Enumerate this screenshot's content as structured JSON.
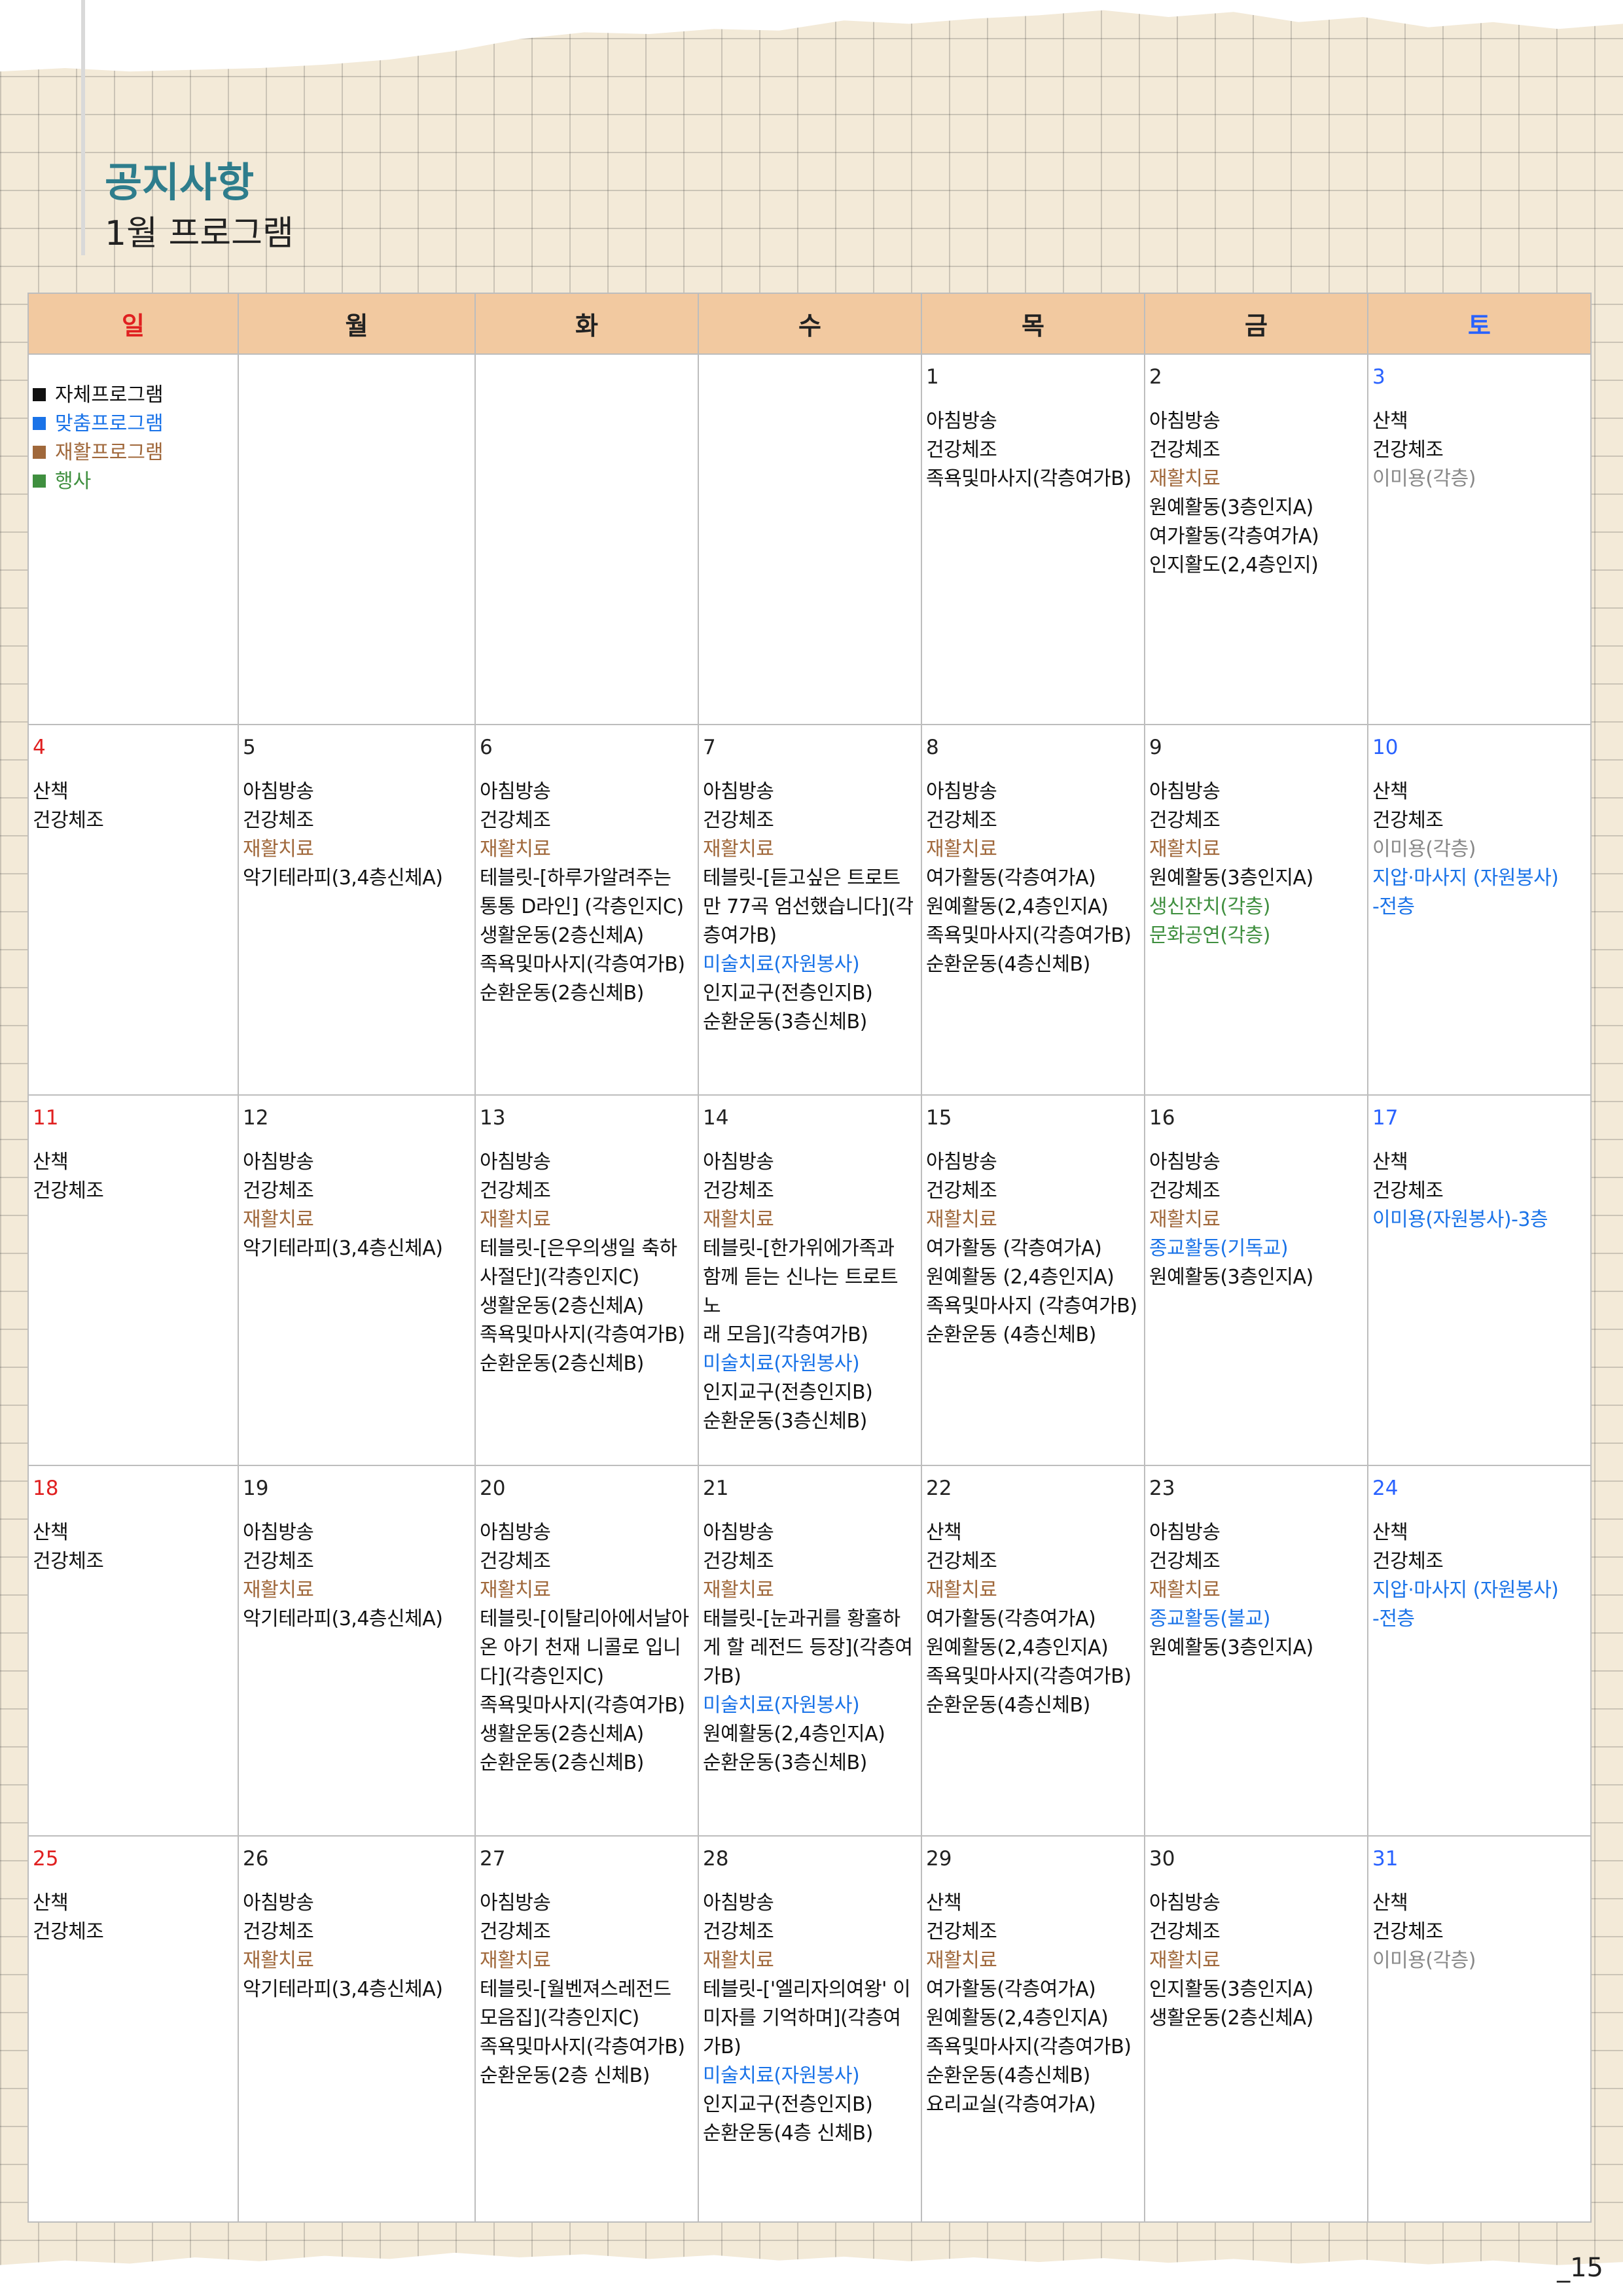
{
  "header": {
    "notice_title": "공지사항",
    "program_title": "1월 프로그램"
  },
  "page_number": "_15",
  "colors": {
    "self": "#000000",
    "custom": "#1a73e8",
    "rehab": "#a0683b",
    "event": "#3f8f3f",
    "sunday": "#e02020",
    "saturday": "#2962ff"
  },
  "weekdays": [
    "일",
    "월",
    "화",
    "수",
    "목",
    "금",
    "토"
  ],
  "legend": [
    {
      "label": "자체프로그램",
      "color": "#111111"
    },
    {
      "label": "맞춤프로그램",
      "color": "#1a73e8"
    },
    {
      "label": "재활프로그램",
      "color": "#a0683b"
    },
    {
      "label": "행사",
      "color": "#3f8f3f"
    }
  ],
  "weeks": [
    [
      null,
      null,
      null,
      null,
      {
        "day": "1",
        "items": [
          [
            "아침방송",
            ""
          ],
          [
            "건강체조",
            ""
          ],
          [
            "족욕및마사지(각층여가B)",
            ""
          ]
        ]
      },
      {
        "day": "2",
        "items": [
          [
            "아침방송",
            ""
          ],
          [
            "건강체조",
            ""
          ],
          [
            "재활치료",
            "rehab"
          ],
          [
            "원예활동(3층인지A)",
            ""
          ],
          [
            "여가활동(각층여가A)",
            ""
          ],
          [
            "인지활도(2,4층인지)",
            ""
          ]
        ]
      },
      {
        "day": "3",
        "items": [
          [
            "산책",
            ""
          ],
          [
            "건강체조",
            ""
          ],
          [
            "이미용(각층)",
            "grey"
          ]
        ]
      }
    ],
    [
      {
        "day": "4",
        "items": [
          [
            "산책",
            ""
          ],
          [
            "건강체조",
            ""
          ]
        ]
      },
      {
        "day": "5",
        "items": [
          [
            "아침방송",
            ""
          ],
          [
            "건강체조",
            ""
          ],
          [
            "재활치료",
            "rehab"
          ],
          [
            "악기테라피(3,4층신체A)",
            ""
          ]
        ]
      },
      {
        "day": "6",
        "items": [
          [
            "아침방송",
            ""
          ],
          [
            "건강체조",
            ""
          ],
          [
            "재활치료",
            "rehab"
          ],
          [
            "테블릿-[하루가알려주는",
            ""
          ],
          [
            "통통 D라인] (각층인지C)",
            ""
          ],
          [
            "생활운동(2층신체A)",
            ""
          ],
          [
            "족욕및마사지(각층여가B)",
            ""
          ],
          [
            "순환운동(2층신체B)",
            ""
          ]
        ]
      },
      {
        "day": "7",
        "items": [
          [
            "아침방송",
            ""
          ],
          [
            "건강체조",
            ""
          ],
          [
            "재활치료",
            "rehab"
          ],
          [
            "테블릿-[듣고싶은 트로트",
            ""
          ],
          [
            "만 77곡 엄선했습니다](각",
            ""
          ],
          [
            "층여가B)",
            ""
          ],
          [
            "미술치료(자원봉사)",
            "custom"
          ],
          [
            "인지교구(전층인지B)",
            ""
          ],
          [
            "순환운동(3층신체B)",
            ""
          ]
        ]
      },
      {
        "day": "8",
        "items": [
          [
            "아침방송",
            ""
          ],
          [
            "건강체조",
            ""
          ],
          [
            "재활치료",
            "rehab"
          ],
          [
            "여가활동(각층여가A)",
            ""
          ],
          [
            "원예활동(2,4층인지A)",
            ""
          ],
          [
            "족욕및마사지(각층여가B)",
            ""
          ],
          [
            "순환운동(4층신체B)",
            ""
          ]
        ]
      },
      {
        "day": "9",
        "items": [
          [
            "아침방송",
            ""
          ],
          [
            "건강체조",
            ""
          ],
          [
            "재활치료",
            "rehab"
          ],
          [
            "원예활동(3층인지A)",
            ""
          ],
          [
            "생신잔치(각층)",
            "event"
          ],
          [
            "문화공연(각층)",
            "event"
          ]
        ]
      },
      {
        "day": "10",
        "items": [
          [
            "산책",
            ""
          ],
          [
            "건강체조",
            ""
          ],
          [
            "이미용(각층)",
            "grey"
          ],
          [
            "지압·마사지 (자원봉사)",
            "custom"
          ],
          [
            "-전층",
            "custom"
          ]
        ]
      }
    ],
    [
      {
        "day": "11",
        "items": [
          [
            "산책",
            ""
          ],
          [
            "건강체조",
            ""
          ]
        ]
      },
      {
        "day": "12",
        "items": [
          [
            "아침방송",
            ""
          ],
          [
            "건강체조",
            ""
          ],
          [
            "재활치료",
            "rehab"
          ],
          [
            "악기테라피(3,4층신체A)",
            ""
          ]
        ]
      },
      {
        "day": "13",
        "items": [
          [
            "아침방송",
            ""
          ],
          [
            "건강체조",
            ""
          ],
          [
            "재활치료",
            "rehab"
          ],
          [
            "테블릿-[은우의생일 축하",
            ""
          ],
          [
            "사절단](각층인지C)",
            ""
          ],
          [
            "생활운동(2층신체A)",
            ""
          ],
          [
            "족욕및마사지(각층여가B)",
            ""
          ],
          [
            "순환운동(2층신체B)",
            ""
          ]
        ]
      },
      {
        "day": "14",
        "items": [
          [
            "아침방송",
            ""
          ],
          [
            "건강체조",
            ""
          ],
          [
            "재활치료",
            "rehab"
          ],
          [
            "테블릿-[한가위에가족과",
            ""
          ],
          [
            "함께 듣는 신나는 트로트 노",
            ""
          ],
          [
            "래 모음](각층여가B)",
            ""
          ],
          [
            "미술치료(자원봉사)",
            "custom"
          ],
          [
            "인지교구(전층인지B)",
            ""
          ],
          [
            "순환운동(3층신체B)",
            ""
          ]
        ]
      },
      {
        "day": "15",
        "items": [
          [
            "아침방송",
            ""
          ],
          [
            "건강체조",
            ""
          ],
          [
            "재활치료",
            "rehab"
          ],
          [
            "여가활동 (각층여가A)",
            ""
          ],
          [
            "원예활동 (2,4층인지A)",
            ""
          ],
          [
            "족욕및마사지 (각층여가B)",
            ""
          ],
          [
            "순환운동 (4층신체B)",
            ""
          ]
        ]
      },
      {
        "day": "16",
        "items": [
          [
            "아침방송",
            ""
          ],
          [
            "건강체조",
            ""
          ],
          [
            "재활치료",
            "rehab"
          ],
          [
            "종교활동(기독교)",
            "custom"
          ],
          [
            "원예활동(3층인지A)",
            ""
          ]
        ]
      },
      {
        "day": "17",
        "items": [
          [
            "산책",
            ""
          ],
          [
            "건강체조",
            ""
          ],
          [
            "이미용(자원봉사)-3층",
            "custom"
          ]
        ]
      }
    ],
    [
      {
        "day": "18",
        "items": [
          [
            "산책",
            ""
          ],
          [
            "건강체조",
            ""
          ]
        ]
      },
      {
        "day": "19",
        "items": [
          [
            "아침방송",
            ""
          ],
          [
            "건강체조",
            ""
          ],
          [
            "재활치료",
            "rehab"
          ],
          [
            "악기테라피(3,4층신체A)",
            ""
          ]
        ]
      },
      {
        "day": "20",
        "items": [
          [
            "아침방송",
            ""
          ],
          [
            "건강체조",
            ""
          ],
          [
            "재활치료",
            "rehab"
          ],
          [
            "테블릿-[이탈리아에서날아",
            ""
          ],
          [
            "온 아기 천재 니콜로 입니",
            ""
          ],
          [
            "다](각층인지C)",
            ""
          ],
          [
            "족욕및마사지(각층여가B)",
            ""
          ],
          [
            "생활운동(2층신체A)",
            ""
          ],
          [
            "순환운동(2층신체B)",
            ""
          ]
        ]
      },
      {
        "day": "21",
        "items": [
          [
            "아침방송",
            ""
          ],
          [
            "건강체조",
            ""
          ],
          [
            "재활치료",
            "rehab"
          ],
          [
            "태블릿-[눈과귀를 황홀하",
            ""
          ],
          [
            "게 할 레전드 등장](각층여",
            ""
          ],
          [
            "가B)",
            ""
          ],
          [
            "미술치료(자원봉사)",
            "custom"
          ],
          [
            "원예활동(2,4층인지A)",
            ""
          ],
          [
            "순환운동(3층신체B)",
            ""
          ]
        ]
      },
      {
        "day": "22",
        "items": [
          [
            "산책",
            ""
          ],
          [
            "건강체조",
            ""
          ],
          [
            "재활치료",
            "rehab"
          ],
          [
            "여가활동(각층여가A)",
            ""
          ],
          [
            "원예활동(2,4층인지A)",
            ""
          ],
          [
            "족욕및마사지(각층여가B)",
            ""
          ],
          [
            "순환운동(4층신체B)",
            ""
          ]
        ]
      },
      {
        "day": "23",
        "items": [
          [
            "아침방송",
            ""
          ],
          [
            "건강체조",
            ""
          ],
          [
            "재활치료",
            "rehab"
          ],
          [
            "종교활동(불교)",
            "custom"
          ],
          [
            "원예활동(3층인지A)",
            ""
          ]
        ]
      },
      {
        "day": "24",
        "items": [
          [
            "산책",
            ""
          ],
          [
            "건강체조",
            ""
          ],
          [
            "지압·마사지 (자원봉사)",
            "custom"
          ],
          [
            "-전층",
            "custom"
          ]
        ]
      }
    ],
    [
      {
        "day": "25",
        "items": [
          [
            "산책",
            ""
          ],
          [
            "건강체조",
            ""
          ]
        ]
      },
      {
        "day": "26",
        "items": [
          [
            "아침방송",
            ""
          ],
          [
            "건강체조",
            ""
          ],
          [
            "재활치료",
            "rehab"
          ],
          [
            "악기테라피(3,4층신체A)",
            ""
          ]
        ]
      },
      {
        "day": "27",
        "items": [
          [
            "아침방송",
            ""
          ],
          [
            "건강체조",
            ""
          ],
          [
            "재활치료",
            "rehab"
          ],
          [
            "테블릿-[월벤져스레전드",
            ""
          ],
          [
            "모음집](각층인지C)",
            ""
          ],
          [
            "족욕및마사지(각층여가B)",
            ""
          ],
          [
            "순환운동(2층 신체B)",
            ""
          ]
        ]
      },
      {
        "day": "28",
        "items": [
          [
            "아침방송",
            ""
          ],
          [
            "건강체조",
            ""
          ],
          [
            "재활치료",
            "rehab"
          ],
          [
            "테블릿-['엘리자의여왕' 이",
            ""
          ],
          [
            "미자를 기억하며](각층여",
            ""
          ],
          [
            "가B)",
            ""
          ],
          [
            "미술치료(자원봉사)",
            "custom"
          ],
          [
            "인지교구(전층인지B)",
            ""
          ],
          [
            "순환운동(4층 신체B)",
            ""
          ]
        ]
      },
      {
        "day": "29",
        "items": [
          [
            "산책",
            ""
          ],
          [
            "건강체조",
            ""
          ],
          [
            "재활치료",
            "rehab"
          ],
          [
            "여가활동(각층여가A)",
            ""
          ],
          [
            "원예활동(2,4층인지A)",
            ""
          ],
          [
            "족욕및마사지(각층여가B)",
            ""
          ],
          [
            "순환운동(4층신체B)",
            ""
          ],
          [
            "요리교실(각층여가A)",
            ""
          ]
        ]
      },
      {
        "day": "30",
        "items": [
          [
            "아침방송",
            ""
          ],
          [
            "건강체조",
            ""
          ],
          [
            "재활치료",
            "rehab"
          ],
          [
            "인지활동(3층인지A)",
            ""
          ],
          [
            "생활운동(2층신체A)",
            ""
          ]
        ]
      },
      {
        "day": "31",
        "items": [
          [
            "산책",
            ""
          ],
          [
            "건강체조",
            ""
          ],
          [
            "이미용(각층)",
            "grey"
          ]
        ]
      }
    ]
  ]
}
